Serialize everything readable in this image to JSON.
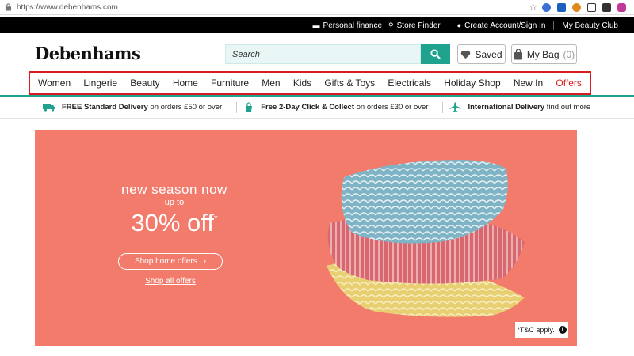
{
  "browser": {
    "url": "https://www.debenhams.com"
  },
  "topbar": {
    "personal_finance": "Personal finance",
    "store_finder": "Store Finder",
    "account": "Create Account/Sign In",
    "beauty_club": "My Beauty Club"
  },
  "header": {
    "logo": "Debenhams",
    "search_placeholder": "Search",
    "saved_label": "Saved",
    "bag_label": "My Bag",
    "bag_count": "(0)"
  },
  "nav": {
    "items": [
      "Women",
      "Lingerie",
      "Beauty",
      "Home",
      "Furniture",
      "Men",
      "Kids",
      "Gifts & Toys",
      "Electricals",
      "Holiday Shop",
      "New In",
      "Offers"
    ]
  },
  "delivery": {
    "item1_bold": "FREE Standard Delivery",
    "item1_rest": "on orders £50 or over",
    "item2_bold": "Free 2-Day Click & Collect",
    "item2_rest": "on orders £30 or over",
    "item3_bold": "International Delivery",
    "item3_rest": "find out more"
  },
  "hero": {
    "line1": "new season now",
    "line2": "up to",
    "line3": "30% off",
    "asterisk": "*",
    "shop_home": "Shop home offers",
    "shop_all": "Shop all offers",
    "tc": "*T&C apply."
  },
  "colors": {
    "accent": "#1fa38f",
    "highlight": "#d71d1d",
    "hero_bg": "#f27b6c"
  }
}
